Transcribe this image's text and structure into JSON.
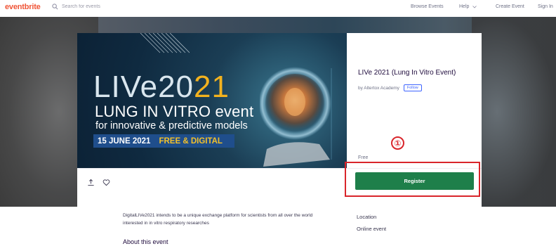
{
  "header": {
    "logo": "eventbrite",
    "search_placeholder": "Search for events",
    "nav": {
      "browse": "Browse Events",
      "help": "Help",
      "create": "Create Event",
      "signin": "Sign In"
    }
  },
  "banner": {
    "title_main": "LIVe20",
    "title_accent": "21",
    "subtitle": "LUNG IN VITRO event",
    "tagline": "for innovative & predictive models",
    "date": "15 JUNE 2021",
    "format": "FREE & DIGITAL"
  },
  "event": {
    "title": "LIVe 2021 (Lung In Vitro Event)",
    "organizer": "by Altertox Academy",
    "follow_label": "Follow",
    "price": "Free",
    "register_label": "Register"
  },
  "body": {
    "description": "DigitalLIVe2021 intends to be a unique exchange platform for scientists from all over the world interested in in vitro respiratory researches",
    "about_heading": "About this event",
    "location_heading": "Location",
    "location_value": "Online event"
  },
  "annotation": {
    "step_number": "①",
    "color": "#d9252b"
  },
  "colors": {
    "brand": "#f05537",
    "register_green": "#1e7f4a",
    "follow_blue": "#3d64ff"
  },
  "icons": {
    "search": "search-icon",
    "help_dropdown": "chevron-down-icon",
    "share": "share-icon",
    "like": "heart-icon"
  }
}
